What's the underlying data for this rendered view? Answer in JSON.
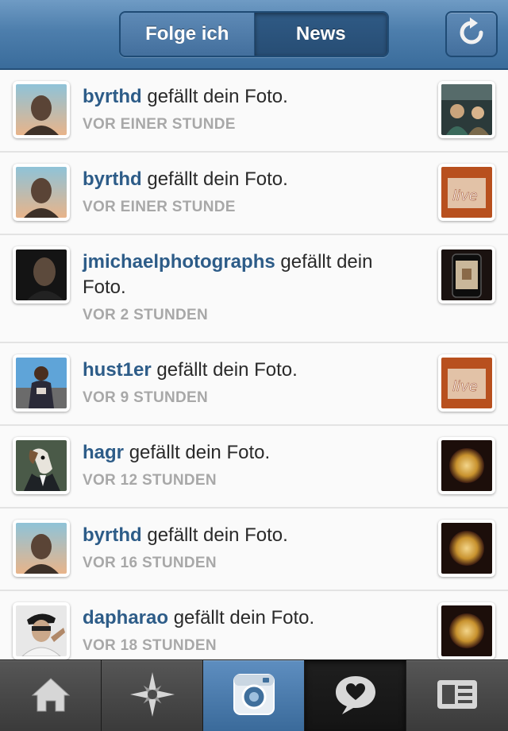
{
  "header": {
    "tabs": [
      {
        "label": "Folge ich",
        "selected": false
      },
      {
        "label": "News",
        "selected": true
      }
    ],
    "refresh_icon": "refresh-icon",
    "colors": {
      "bar": "#4d7eac",
      "username": "#2d5c88",
      "time": "#a8a8a8"
    }
  },
  "feed": [
    {
      "user": "byrthd",
      "action": "gefällt dein Foto.",
      "time": "VOR EINER STUNDE",
      "avatar": "man-sky",
      "thumb": "people-photo"
    },
    {
      "user": "byrthd",
      "action": "gefällt dein Foto.",
      "time": "VOR EINER STUNDE",
      "avatar": "man-sky",
      "thumb": "live-sign"
    },
    {
      "user": "jmichaelphotographs",
      "action": "gefällt dein Foto.",
      "time": "VOR 2 STUNDEN",
      "avatar": "dark-portrait",
      "thumb": "phone-photo"
    },
    {
      "user": "hust1er",
      "action": "gefällt dein Foto.",
      "time": "VOR 9 STUNDEN",
      "avatar": "man-outdoor",
      "thumb": "live-sign"
    },
    {
      "user": "hagr",
      "action": "gefällt dein Foto.",
      "time": "VOR 12 STUNDEN",
      "avatar": "dog-suit",
      "thumb": "sun-circle"
    },
    {
      "user": "byrthd",
      "action": "gefällt dein Foto.",
      "time": "VOR 16 STUNDEN",
      "avatar": "man-sky",
      "thumb": "sun-circle"
    },
    {
      "user": "dapharao",
      "action": "gefällt dein Foto.",
      "time": "VOR 18 STUNDEN",
      "avatar": "man-cap",
      "thumb": "sun-circle"
    }
  ],
  "tabbar": {
    "items": [
      {
        "icon": "home-icon",
        "state": "normal"
      },
      {
        "icon": "explore-star-icon",
        "state": "normal"
      },
      {
        "icon": "camera-icon",
        "state": "highlight"
      },
      {
        "icon": "news-heart-bubble-icon",
        "state": "active"
      },
      {
        "icon": "profile-card-icon",
        "state": "normal"
      }
    ]
  }
}
